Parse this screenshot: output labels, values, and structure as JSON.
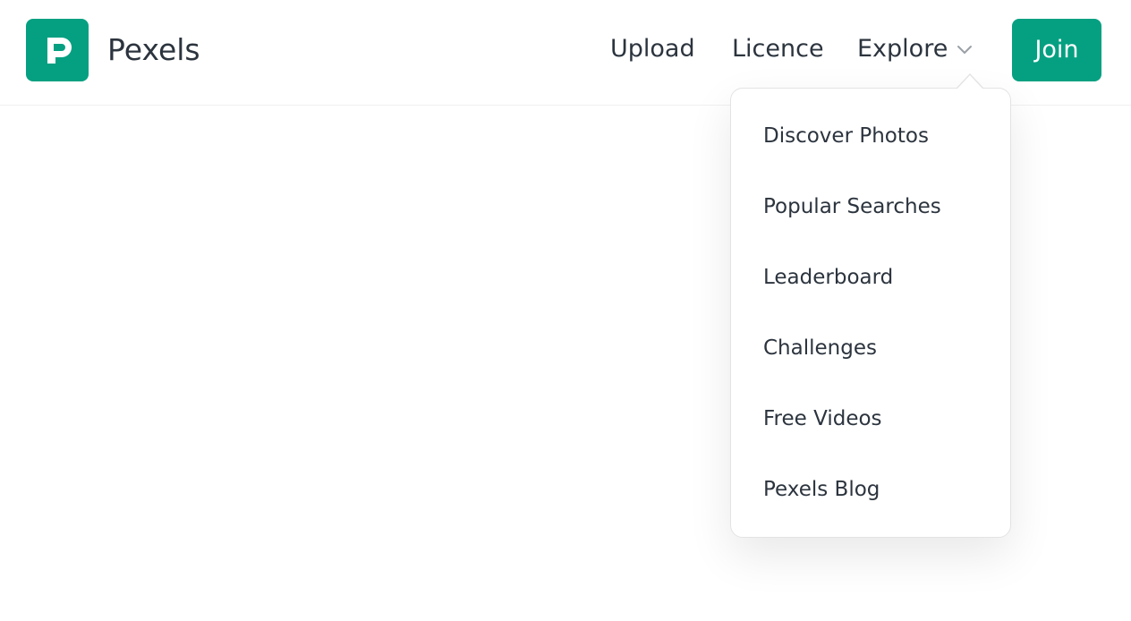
{
  "header": {
    "brand": "Pexels",
    "logo_icon": "pexels-logo-icon",
    "brand_color": "#05a081",
    "nav": {
      "upload": "Upload",
      "licence": "Licence",
      "explore": "Explore"
    },
    "explore_chevron_icon": "chevron-down-icon",
    "join": "Join"
  },
  "explore_menu": {
    "items": [
      "Discover Photos",
      "Popular Searches",
      "Leaderboard",
      "Challenges",
      "Free Videos",
      "Pexels Blog"
    ]
  }
}
